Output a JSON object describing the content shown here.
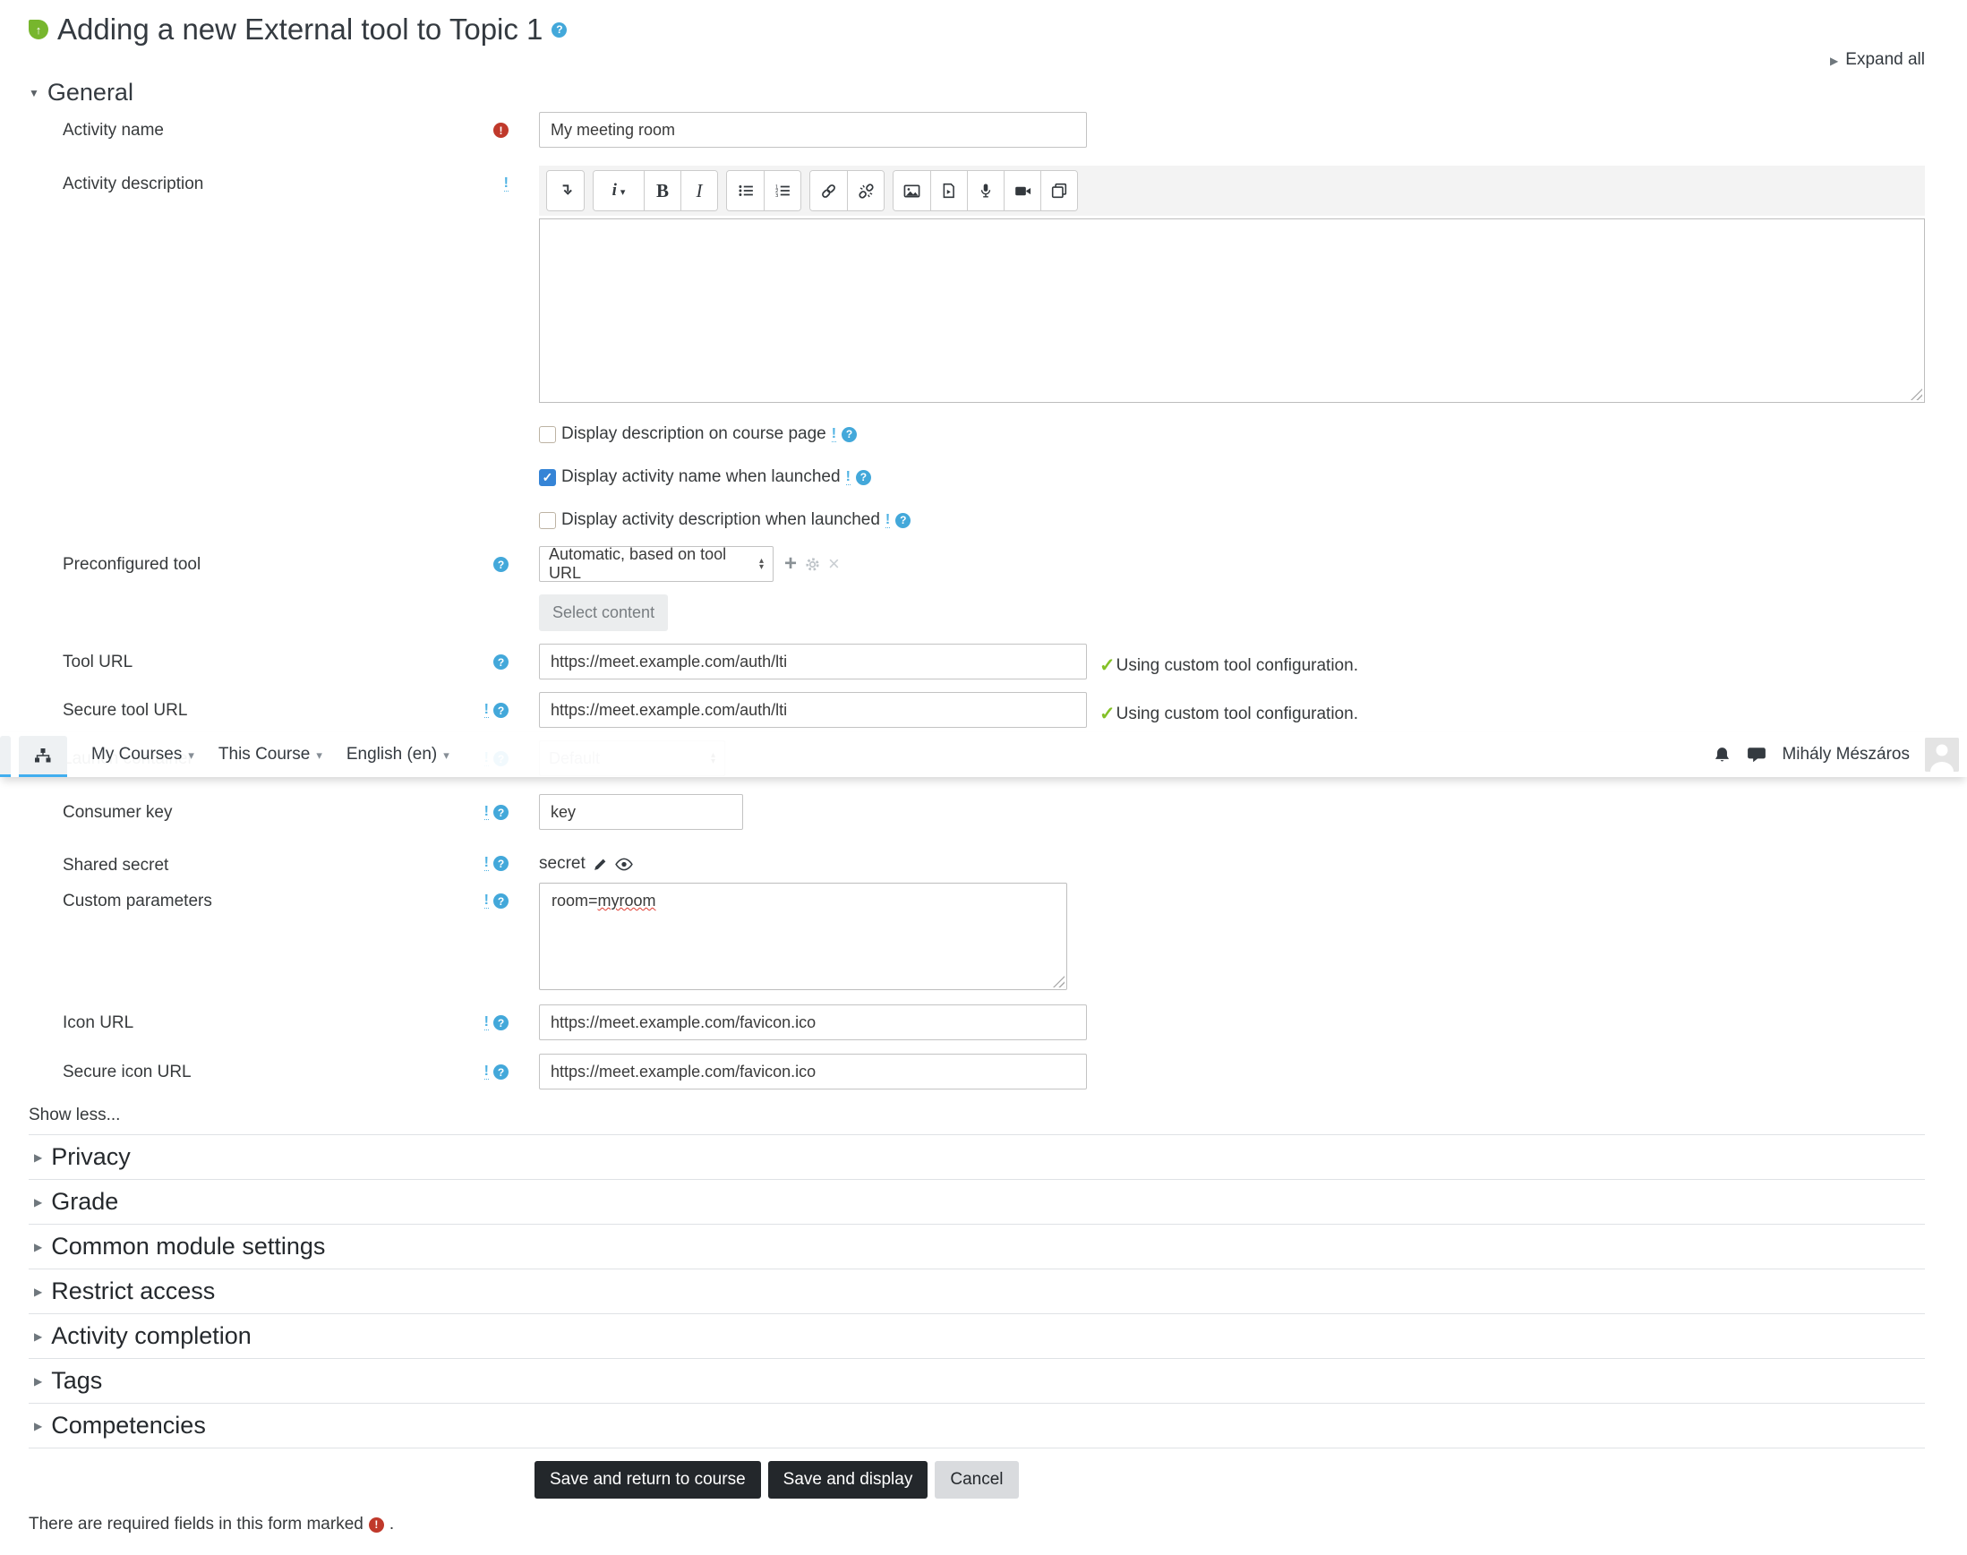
{
  "header": {
    "title": "Adding a new External tool to Topic 1",
    "expand_all": "Expand all"
  },
  "navbar": {
    "menus": [
      {
        "label": "My Courses"
      },
      {
        "label": "This Course"
      },
      {
        "label": "English (en)"
      }
    ],
    "user_name": "Mihály Mészáros"
  },
  "general": {
    "heading": "General",
    "activity_name": {
      "label": "Activity name",
      "value": "My meeting room"
    },
    "activity_description": {
      "label": "Activity description"
    },
    "editor": {
      "paragraph_glyph": "i",
      "bold_glyph": "B",
      "italic_glyph": "I"
    },
    "checkboxes": [
      {
        "label": "Display description on course page",
        "checked": false
      },
      {
        "label": "Display activity name when launched",
        "checked": true
      },
      {
        "label": "Display activity description when launched",
        "checked": false
      }
    ],
    "preconfigured_tool": {
      "label": "Preconfigured tool",
      "value": "Automatic, based on tool URL",
      "select_content_label": "Select content"
    },
    "tool_url": {
      "label": "Tool URL",
      "value": "https://meet.example.com/auth/lti",
      "status": "Using custom tool configuration."
    },
    "secure_tool_url": {
      "label": "Secure tool URL",
      "value": "https://meet.example.com/auth/lti",
      "status": "Using custom tool configuration."
    },
    "launch_container": {
      "label": "Launch container",
      "value": "Default"
    },
    "consumer_key": {
      "label": "Consumer key",
      "value": "key"
    },
    "shared_secret": {
      "label": "Shared secret",
      "value": "secret"
    },
    "custom_parameters": {
      "label": "Custom parameters",
      "value": "room=myroom",
      "value_prefix": "room=",
      "value_flagged": "myroom"
    },
    "icon_url": {
      "label": "Icon URL",
      "value": "https://meet.example.com/favicon.ico"
    },
    "secure_icon_url": {
      "label": "Secure icon URL",
      "value": "https://meet.example.com/favicon.ico"
    },
    "show_less": "Show less..."
  },
  "sections": [
    {
      "label": "Privacy"
    },
    {
      "label": "Grade"
    },
    {
      "label": "Common module settings"
    },
    {
      "label": "Restrict access"
    },
    {
      "label": "Activity completion"
    },
    {
      "label": "Tags"
    },
    {
      "label": "Competencies"
    }
  ],
  "actions": {
    "save_and_return": "Save and return to course",
    "save_and_display": "Save and display",
    "cancel": "Cancel"
  },
  "footer": {
    "required_text": "There are required fields in this form marked",
    "suffix": "."
  },
  "colors": {
    "accent_blue": "#41aeef",
    "help_blue": "#43a8da",
    "required_red": "#c0392b",
    "success_green": "#84c127",
    "checkbox_blue": "#3584d6",
    "primary_dark": "#23272b"
  }
}
